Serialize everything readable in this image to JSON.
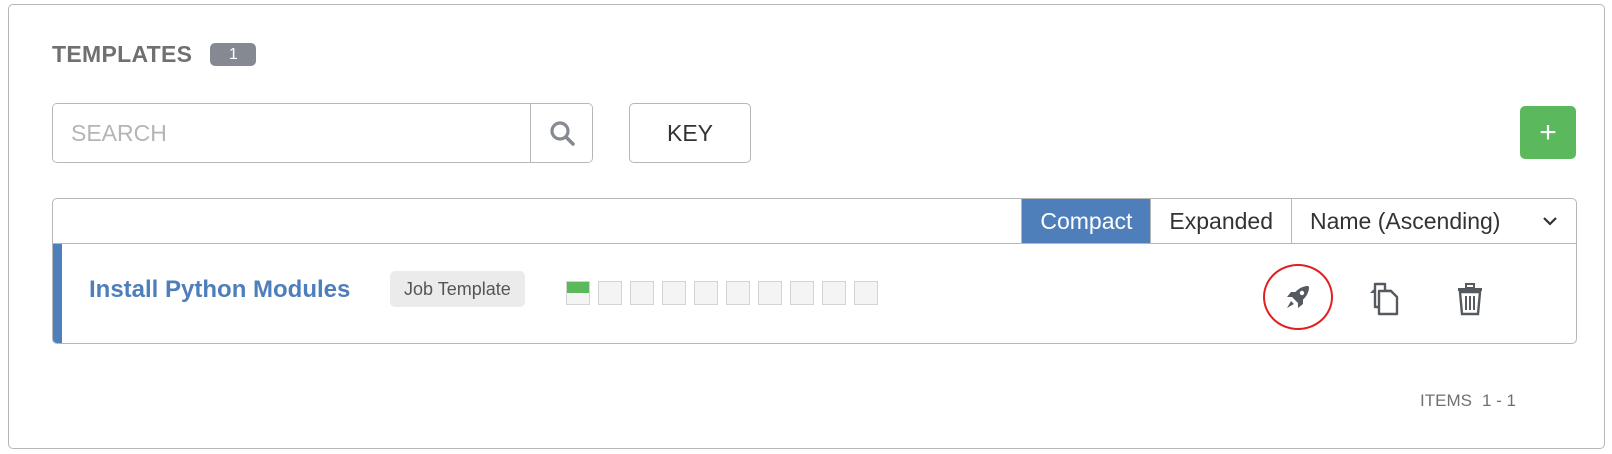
{
  "header": {
    "title": "TEMPLATES",
    "count": "1"
  },
  "search": {
    "placeholder": "SEARCH",
    "icon": "search-icon"
  },
  "key_button": {
    "label": "KEY"
  },
  "add_button": {
    "label": "+"
  },
  "list": {
    "view_modes": [
      "Compact",
      "Expanded"
    ],
    "active_view": "Compact",
    "sort": {
      "selected": "Name (Ascending)"
    },
    "rows": [
      {
        "name": "Install Python Modules",
        "type": "Job Template",
        "recent_jobs": [
          "successful",
          "none",
          "none",
          "none",
          "none",
          "none",
          "none",
          "none",
          "none",
          "none"
        ],
        "actions": [
          "rocket-icon",
          "copy-icon",
          "trash-icon"
        ]
      }
    ]
  },
  "pagination": {
    "items_label": "ITEMS",
    "range": "1 - 1"
  },
  "colors": {
    "accent_blue": "#4f7fbb",
    "success_green": "#5cb85c",
    "badge_gray": "#848992",
    "highlight_red": "#e02020"
  }
}
